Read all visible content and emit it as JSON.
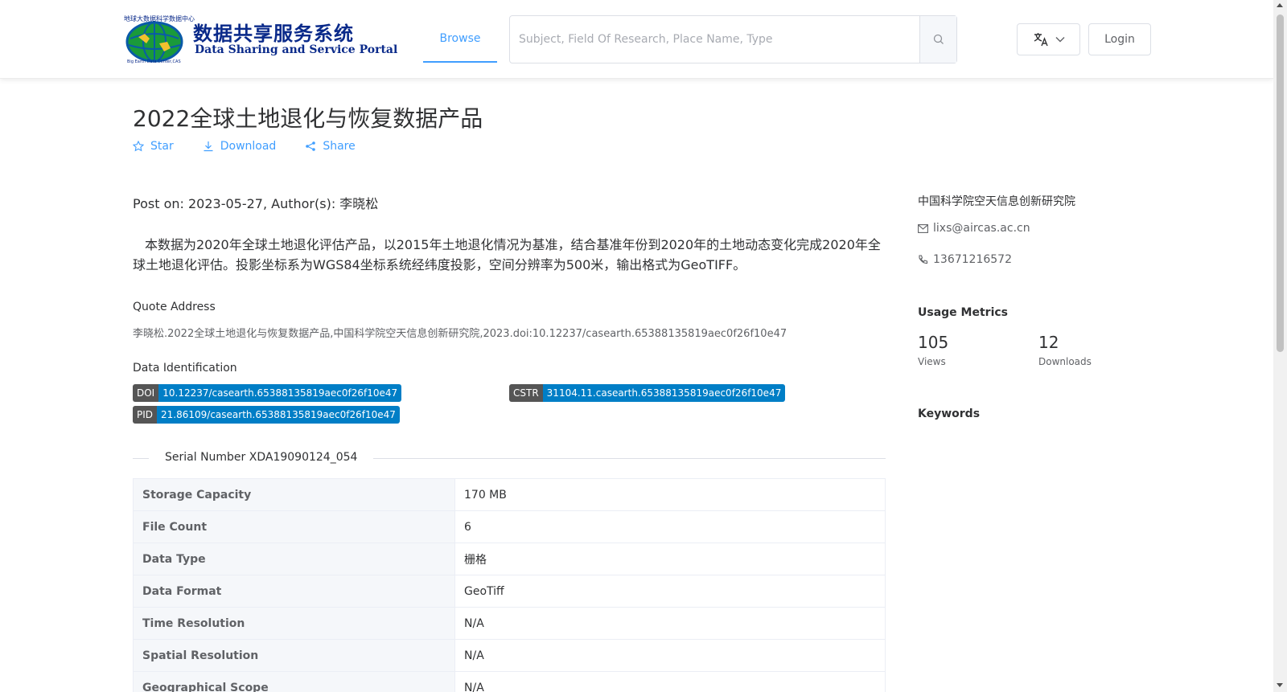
{
  "header": {
    "logo_cn": "数据共享服务系统",
    "logo_en": "Data Sharing and Service Portal",
    "logo_ring_text": "地球大数据科学数据中心",
    "logo_sub_text": "Big Earth Data Center,CAS",
    "nav_browse": "Browse",
    "search_placeholder": "Subject, Field Of Research, Place Name, Type",
    "login": "Login"
  },
  "dataset": {
    "title": "2022全球土地退化与恢复数据产品",
    "actions": {
      "star": "Star",
      "download": "Download",
      "share": "Share"
    },
    "meta_line": "Post on: 2023-05-27, Author(s): 李晓松",
    "description": "本数据为2020年全球土地退化评估产品，以2015年土地退化情况为基准，结合基准年份到2020年的土地动态变化完成2020年全球土地退化评估。投影坐标系为WGS84坐标系统经纬度投影，空间分辨率为500米，输出格式为GeoTIFF。",
    "quote_label": "Quote Address",
    "quote_text": "李晓松.2022全球土地退化与恢复数据产品,中国科学院空天信息创新研究院,2023.doi:10.12237/casearth.65388135819aec0f26f10e47",
    "identification_label": "Data Identification",
    "badges": {
      "doi": {
        "key": "DOI",
        "value": "10.12237/casearth.65388135819aec0f26f10e47"
      },
      "cstr": {
        "key": "CSTR",
        "value": "31104.11.casearth.65388135819aec0f26f10e47"
      },
      "pid": {
        "key": "PID",
        "value": "21.86109/casearth.65388135819aec0f26f10e47"
      }
    },
    "serial_number": "Serial Number XDA19090124_054",
    "info": [
      {
        "key": "Storage Capacity",
        "value": "170 MB"
      },
      {
        "key": "File Count",
        "value": "6"
      },
      {
        "key": "Data Type",
        "value": "栅格"
      },
      {
        "key": "Data Format",
        "value": "GeoTiff"
      },
      {
        "key": "Time Resolution",
        "value": "N/A"
      },
      {
        "key": "Spatial Resolution",
        "value": "N/A"
      },
      {
        "key": "Geographical Scope",
        "value": "N/A"
      }
    ]
  },
  "sidebar": {
    "organization": "中国科学院空天信息创新研究院",
    "email": "lixs@aircas.ac.cn",
    "phone": "13671216572",
    "usage_title": "Usage Metrics",
    "views_count": "105",
    "views_label": "Views",
    "downloads_count": "12",
    "downloads_label": "Downloads",
    "keywords_title": "Keywords"
  },
  "colors": {
    "accent": "#409eff",
    "badge_key": "#555555",
    "badge_value": "#007ec6",
    "logo_text": "#0a2a8a"
  },
  "icons": {
    "star": "star-icon",
    "download": "download-icon",
    "share": "share-icon",
    "search": "search-icon",
    "translate": "translate-icon",
    "chevron": "chevron-down-icon",
    "mail": "mail-icon",
    "phone": "phone-icon",
    "logo": "globe-logo-icon"
  }
}
